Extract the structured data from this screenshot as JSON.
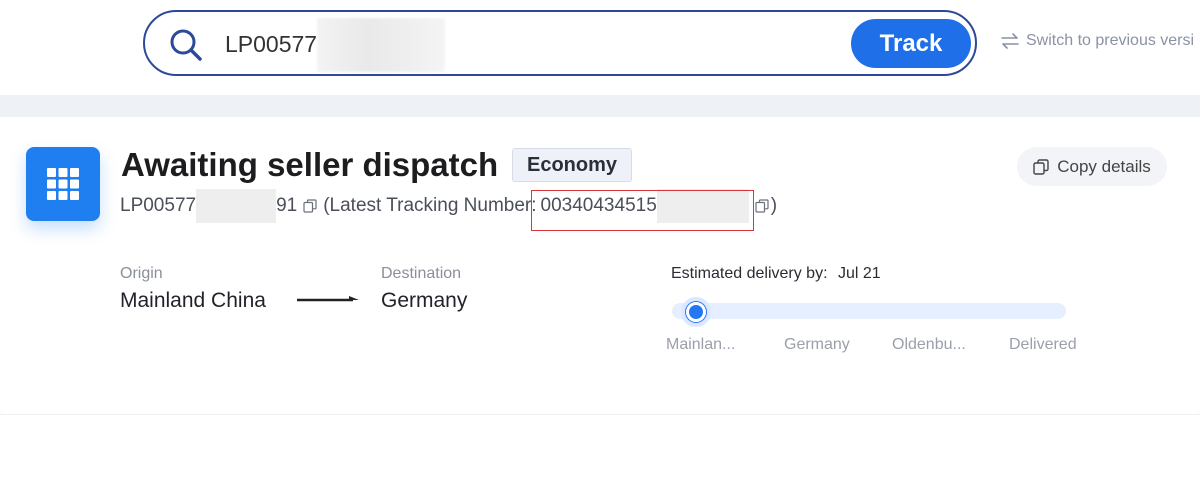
{
  "search": {
    "value": "LP00577",
    "button_label": "Track",
    "switch_label": "Switch to previous versi"
  },
  "shipment": {
    "status_title": "Awaiting seller dispatch",
    "service_badge": "Economy",
    "copy_details_label": "Copy details",
    "order_prefix": "LP00577",
    "order_suffix": "91",
    "latest_tracking_label": "(Latest Tracking Number:",
    "latest_tracking_number": "00340434515",
    "latest_tracking_close": ")"
  },
  "route": {
    "origin_label": "Origin",
    "origin_value": "Mainland China",
    "destination_label": "Destination",
    "destination_value": "Germany"
  },
  "delivery": {
    "eta_label": "Estimated delivery by:",
    "eta_value": "Jul 21",
    "progress": 0,
    "steps": [
      "Mainlan...",
      "Germany",
      "Oldenbu...",
      "Delivered"
    ]
  },
  "colors": {
    "accent": "#1f6fe8",
    "search_border": "#2d4a9a",
    "highlight": "#d9373b"
  }
}
